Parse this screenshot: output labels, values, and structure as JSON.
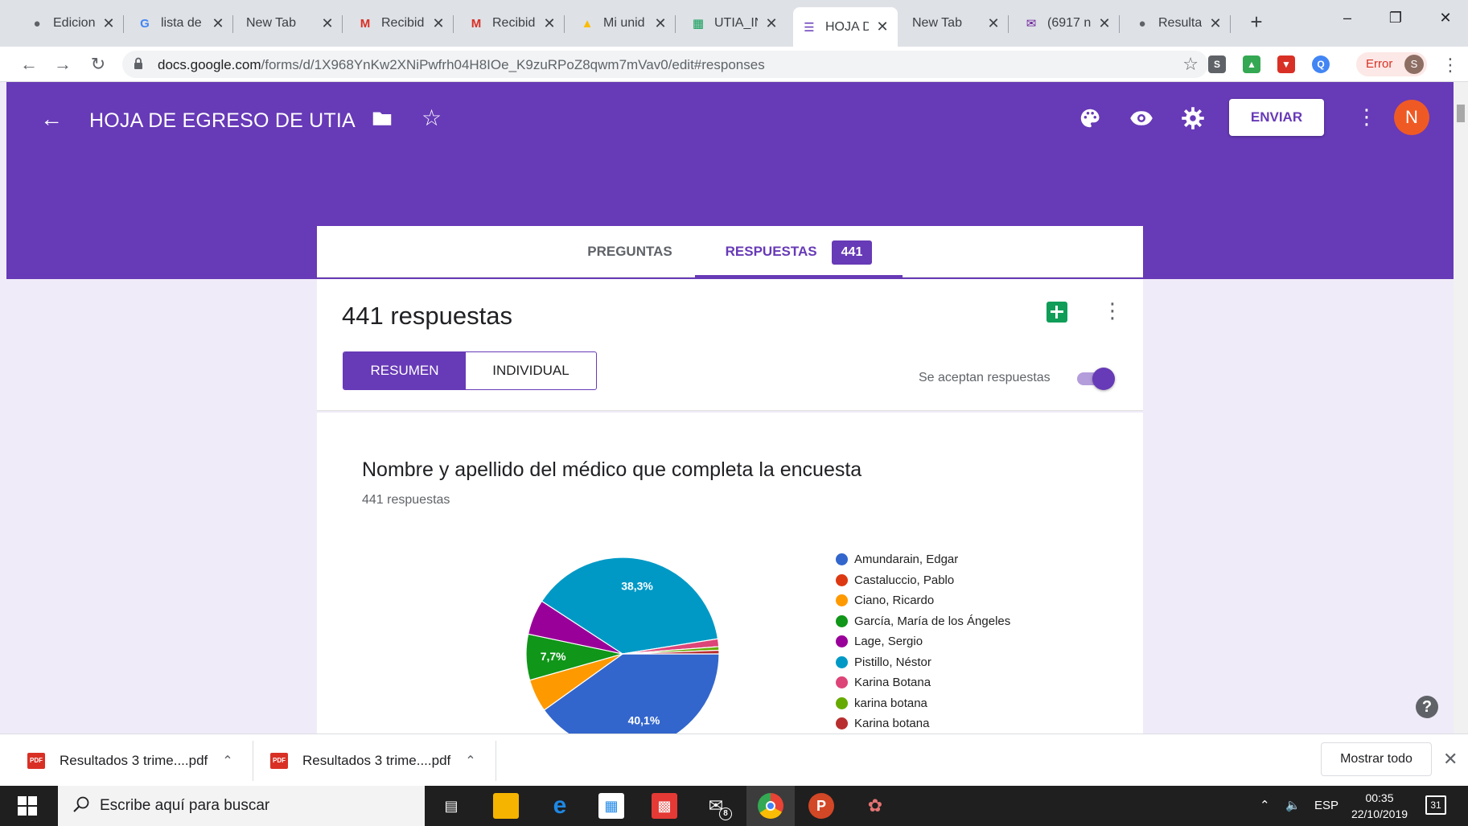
{
  "browser": {
    "tabs": [
      {
        "label": "Edicion",
        "icon": "globe-icon",
        "x": 26,
        "w": 128
      },
      {
        "label": "lista de",
        "icon": "google-icon",
        "x": 160,
        "w": 130
      },
      {
        "label": "New Tab",
        "icon": "",
        "x": 296,
        "w": 130
      },
      {
        "label": "Recibid",
        "icon": "gmail-icon",
        "x": 434,
        "w": 130
      },
      {
        "label": "Recibid",
        "icon": "gmail-icon",
        "x": 572,
        "w": 130
      },
      {
        "label": "Mi unid",
        "icon": "drive-icon",
        "x": 710,
        "w": 130
      },
      {
        "label": "UTIA_IN",
        "icon": "sheets-icon",
        "x": 848,
        "w": 130
      },
      {
        "label": "HOJA D",
        "icon": "forms-icon",
        "x": 986,
        "w": 130
      },
      {
        "label": "New Tab",
        "icon": "",
        "x": 1124,
        "w": 130
      },
      {
        "label": "(6917 n",
        "icon": "mail-icon",
        "x": 1262,
        "w": 130
      },
      {
        "label": "Resulta",
        "icon": "globe-icon",
        "x": 1400,
        "w": 130
      }
    ],
    "url_host": "docs.google.com",
    "url_path": "/forms/d/1X968YnKw2XNiPwfrh04H8IOe_K9zuRPoZ8qwm7mVav0/edit#responses",
    "profile_status": "Error",
    "profile_initial": "S"
  },
  "form": {
    "title": "HOJA DE EGRESO DE UTIA",
    "send_label": "ENVIAR",
    "user_initial": "N",
    "tab_questions": "PREGUNTAS",
    "tab_responses": "RESPUESTAS",
    "responses_badge": "441",
    "responses_heading": "441 respuestas",
    "view_summary": "RESUMEN",
    "view_individual": "INDIVIDUAL",
    "accepting_label": "Se aceptan respuestas"
  },
  "question": {
    "title": "Nombre y apellido del médico que completa la encuesta",
    "count": "441 respuestas"
  },
  "chart_data": {
    "type": "pie",
    "series": [
      {
        "name": "Amundarain, Edgar",
        "value": 40.1,
        "color": "#3366cc",
        "label": "40,1%"
      },
      {
        "name": "Castaluccio, Pablo",
        "value": 0,
        "color": "#dc3912",
        "label": ""
      },
      {
        "name": "Ciano, Ricardo",
        "value": 5.5,
        "color": "#ff9900",
        "label": ""
      },
      {
        "name": "García, María de los Ángeles",
        "value": 7.7,
        "color": "#109618",
        "label": "7,7%"
      },
      {
        "name": "Lage, Sergio",
        "value": 5.9,
        "color": "#990099",
        "label": ""
      },
      {
        "name": "Pistillo, Néstor",
        "value": 38.3,
        "color": "#0099c6",
        "label": "38,3%"
      },
      {
        "name": "Karina Botana",
        "value": 1.3,
        "color": "#dd4477",
        "label": ""
      },
      {
        "name": "karina botana",
        "value": 0.6,
        "color": "#66aa00",
        "label": ""
      },
      {
        "name": "Karina botana",
        "value": 0.6,
        "color": "#b82e2e",
        "label": ""
      }
    ]
  },
  "downloads": {
    "items": [
      "Resultados 3 trime....pdf",
      "Resultados 3 trime....pdf"
    ],
    "show_all": "Mostrar todo"
  },
  "taskbar": {
    "search_placeholder": "Escribe aquí para buscar",
    "mail_badge": "8",
    "language": "ESP",
    "time": "00:35",
    "date": "22/10/2019",
    "notifications": "31"
  }
}
